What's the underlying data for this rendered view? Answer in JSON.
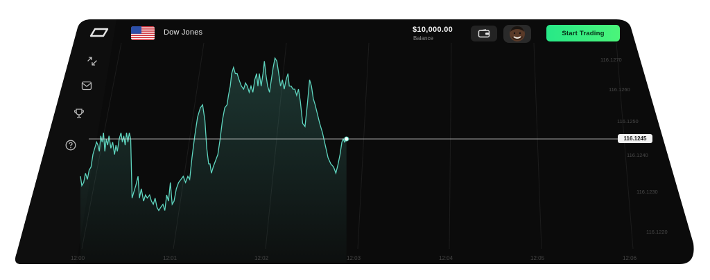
{
  "header": {
    "asset_name": "Dow Jones",
    "balance_amount": "$10,000.00",
    "balance_label": "Balance",
    "start_button": "Start Trading"
  },
  "sidebar": {
    "icons": [
      "trade-arrows-icon",
      "mail-icon",
      "trophy-icon",
      "help-icon"
    ]
  },
  "chart_data": {
    "type": "area",
    "x_ticks": [
      "12:00",
      "12:01",
      "12:02",
      "12:03",
      "12:04",
      "12:05",
      "12:06"
    ],
    "y_ticks": [
      "116.1270",
      "116.1260",
      "116.1250",
      "116.1240",
      "116.1230",
      "116.1220"
    ],
    "current_price": "116.1245",
    "series": [
      {
        "values": [
          [
            12.0,
            116.1233
          ],
          [
            12.015,
            116.123
          ],
          [
            12.035,
            116.1231
          ],
          [
            12.055,
            116.1234
          ],
          [
            12.075,
            116.1232
          ],
          [
            12.095,
            116.1235
          ],
          [
            12.115,
            116.1236
          ],
          [
            12.135,
            116.124
          ],
          [
            12.155,
            116.1242
          ],
          [
            12.175,
            116.1244
          ],
          [
            12.19,
            116.1243
          ],
          [
            12.205,
            116.1241
          ],
          [
            12.22,
            116.1246
          ],
          [
            12.235,
            116.1244
          ],
          [
            12.25,
            116.1247
          ],
          [
            12.265,
            116.1241
          ],
          [
            12.28,
            116.1245
          ],
          [
            12.295,
            116.1243
          ],
          [
            12.31,
            116.1246
          ],
          [
            12.33,
            116.1242
          ],
          [
            12.35,
            116.1244
          ],
          [
            12.37,
            116.124
          ],
          [
            12.385,
            116.1243
          ],
          [
            12.4,
            116.1241
          ],
          [
            12.42,
            116.1245
          ],
          [
            12.44,
            116.1247
          ],
          [
            12.455,
            116.1244
          ],
          [
            12.47,
            116.1246
          ],
          [
            12.485,
            116.1243
          ],
          [
            12.5,
            116.1247
          ],
          [
            12.515,
            116.1244
          ],
          [
            12.53,
            116.1247
          ],
          [
            12.545,
            116.1245
          ],
          [
            12.56,
            116.1226
          ],
          [
            12.58,
            116.1228
          ],
          [
            12.6,
            116.123
          ],
          [
            12.625,
            116.1233
          ],
          [
            12.64,
            116.1226
          ],
          [
            12.66,
            116.1229
          ],
          [
            12.685,
            116.1225
          ],
          [
            12.705,
            116.1227
          ],
          [
            12.725,
            116.1226
          ],
          [
            12.75,
            116.1227
          ],
          [
            12.77,
            116.1225
          ],
          [
            12.79,
            116.1224
          ],
          [
            12.81,
            116.1226
          ],
          [
            12.83,
            116.1223
          ],
          [
            12.85,
            116.1222
          ],
          [
            12.87,
            116.1223
          ],
          [
            12.895,
            116.1224
          ],
          [
            12.915,
            116.1222
          ],
          [
            12.935,
            116.1227
          ],
          [
            12.955,
            116.1225
          ],
          [
            12.975,
            116.1231
          ],
          [
            12.995,
            116.1224
          ],
          [
            13.015,
            116.1225
          ],
          [
            13.04,
            116.1229
          ],
          [
            13.065,
            116.1231
          ],
          [
            13.09,
            116.1232
          ],
          [
            13.115,
            116.1233
          ],
          [
            13.14,
            116.1231
          ],
          [
            13.165,
            116.1233
          ],
          [
            13.185,
            116.1232
          ],
          [
            13.21,
            116.1239
          ],
          [
            13.24,
            116.1246
          ],
          [
            13.27,
            116.1252
          ],
          [
            13.3,
            116.1255
          ],
          [
            13.325,
            116.1256
          ],
          [
            13.35,
            116.1251
          ],
          [
            13.37,
            116.1242
          ],
          [
            13.39,
            116.1237
          ],
          [
            13.405,
            116.1237
          ],
          [
            13.42,
            116.1234
          ],
          [
            13.44,
            116.1236
          ],
          [
            13.465,
            116.1238
          ],
          [
            13.49,
            116.124
          ],
          [
            13.515,
            116.1245
          ],
          [
            13.54,
            116.1251
          ],
          [
            13.565,
            116.1255
          ],
          [
            13.59,
            116.1256
          ],
          [
            13.605,
            116.1259
          ],
          [
            13.625,
            116.1262
          ],
          [
            13.64,
            116.1266
          ],
          [
            13.66,
            116.1268
          ],
          [
            13.68,
            116.1266
          ],
          [
            13.7,
            116.1266
          ],
          [
            13.72,
            116.1264
          ],
          [
            13.745,
            116.1262
          ],
          [
            13.77,
            116.1261
          ],
          [
            13.79,
            116.1263
          ],
          [
            13.81,
            116.1262
          ],
          [
            13.83,
            116.126
          ],
          [
            13.85,
            116.1262
          ],
          [
            13.87,
            116.126
          ],
          [
            13.89,
            116.1264
          ],
          [
            13.91,
            116.1266
          ],
          [
            13.925,
            116.1262
          ],
          [
            13.94,
            116.1266
          ],
          [
            13.96,
            116.1262
          ],
          [
            13.98,
            116.1266
          ],
          [
            13.995,
            116.127
          ],
          [
            14.01,
            116.1266
          ],
          [
            14.03,
            116.1262
          ],
          [
            14.05,
            116.126
          ],
          [
            14.07,
            116.1264
          ],
          [
            14.09,
            116.1268
          ],
          [
            14.11,
            116.1271
          ],
          [
            14.13,
            116.127
          ],
          [
            14.15,
            116.1266
          ],
          [
            14.17,
            116.1262
          ],
          [
            14.19,
            116.1264
          ],
          [
            14.21,
            116.1261
          ],
          [
            14.23,
            116.1264
          ],
          [
            14.25,
            116.1266
          ],
          [
            14.265,
            116.1262
          ],
          [
            14.285,
            116.1262
          ],
          [
            14.305,
            116.1261
          ],
          [
            14.325,
            116.1261
          ],
          [
            14.345,
            116.1259
          ],
          [
            14.365,
            116.1261
          ],
          [
            14.385,
            116.1257
          ],
          [
            14.41,
            116.125
          ],
          [
            14.435,
            116.1249
          ],
          [
            14.46,
            116.1256
          ],
          [
            14.485,
            116.1264
          ],
          [
            14.505,
            116.1262
          ],
          [
            14.525,
            116.1258
          ],
          [
            14.545,
            116.1256
          ],
          [
            14.57,
            116.1253
          ],
          [
            14.595,
            116.125
          ],
          [
            14.625,
            116.1247
          ],
          [
            14.655,
            116.1243
          ],
          [
            14.685,
            116.1239
          ],
          [
            14.715,
            116.1237
          ],
          [
            14.745,
            116.1236
          ],
          [
            14.77,
            116.1234
          ],
          [
            14.795,
            116.1237
          ],
          [
            14.815,
            116.124
          ],
          [
            14.835,
            116.1244
          ],
          [
            14.85,
            116.1245
          ],
          [
            14.865,
            116.1244
          ],
          [
            14.885,
            116.1245
          ]
        ]
      }
    ],
    "colors": {
      "line": "#5fd6c0",
      "accent": "#2fe88a",
      "background": "#0b0b0b"
    }
  }
}
